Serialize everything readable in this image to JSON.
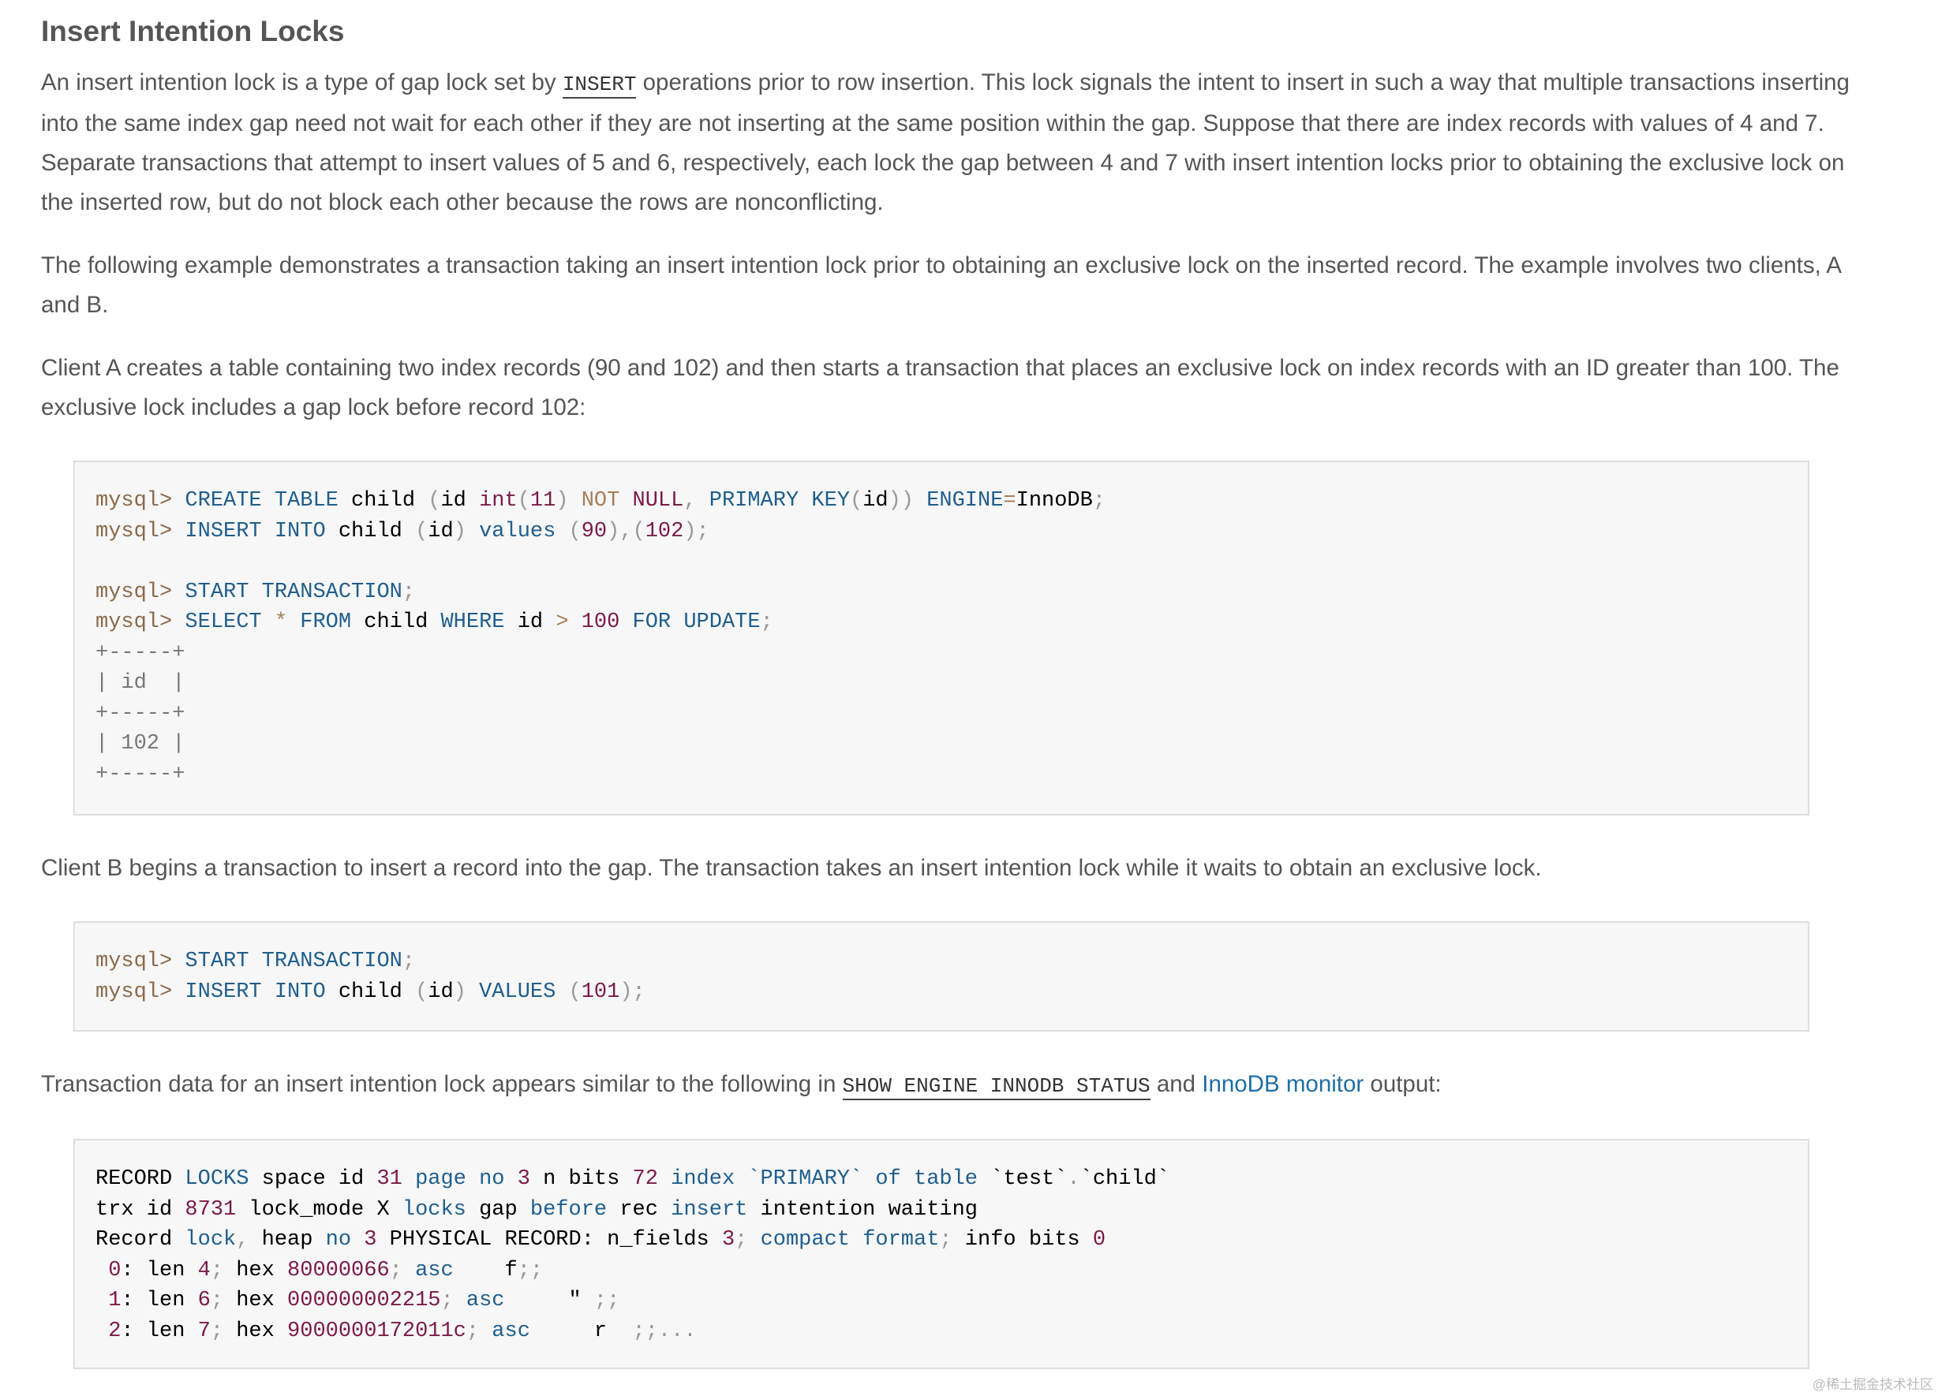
{
  "heading": "Insert Intention Locks",
  "paragraphs": {
    "p1_before": "An insert intention lock is a type of gap lock set by ",
    "p1_code": "INSERT",
    "p1_after": " operations prior to row insertion. This lock signals the intent to insert in such a way that multiple transactions inserting into the same index gap need not wait for each other if they are not inserting at the same position within the gap. Suppose that there are index records with values of 4 and 7. Separate transactions that attempt to insert values of 5 and 6, respectively, each lock the gap between 4 and 7 with insert intention locks prior to obtaining the exclusive lock on the inserted row, but do not block each other because the rows are nonconflicting.",
    "p2": "The following example demonstrates a transaction taking an insert intention lock prior to obtaining an exclusive lock on the inserted record. The example involves two clients, A and B.",
    "p3": "Client A creates a table containing two index records (90 and 102) and then starts a transaction that places an exclusive lock on index records with an ID greater than 100. The exclusive lock includes a gap lock before record 102:",
    "p4": "Client B begins a transaction to insert a record into the gap. The transaction takes an insert intention lock while it waits to obtain an exclusive lock.",
    "p5_before": "Transaction data for an insert intention lock appears similar to the following in ",
    "p5_code": "SHOW ENGINE INNODB STATUS",
    "p5_mid": " and ",
    "p5_link": "InnoDB monitor",
    "p5_after": " output:"
  },
  "code_blocks": {
    "client_a": [
      "mysql> CREATE TABLE child (id int(11) NOT NULL, PRIMARY KEY(id)) ENGINE=InnoDB;",
      "mysql> INSERT INTO child (id) values (90),(102);",
      "",
      "mysql> START TRANSACTION;",
      "mysql> SELECT * FROM child WHERE id > 100 FOR UPDATE;",
      "+-----+",
      "| id  |",
      "+-----+",
      "| 102 |",
      "+-----+"
    ],
    "client_b": [
      "mysql> START TRANSACTION;",
      "mysql> INSERT INTO child (id) VALUES (101);"
    ],
    "monitor_output": [
      "RECORD LOCKS space id 31 page no 3 n bits 72 index `PRIMARY` of table `test`.`child`",
      "trx id 8731 lock_mode X locks gap before rec insert intention waiting",
      "Record lock, heap no 3 PHYSICAL RECORD: n_fields 3; compact format; info bits 0",
      " 0: len 4; hex 80000066; asc    f;;",
      " 1: len 6; hex 000000002215; asc     \" ;;",
      " 2: len 7; hex 9000000172011c; asc     r  ;;..."
    ]
  },
  "watermark": "@稀土掘金技术社区"
}
